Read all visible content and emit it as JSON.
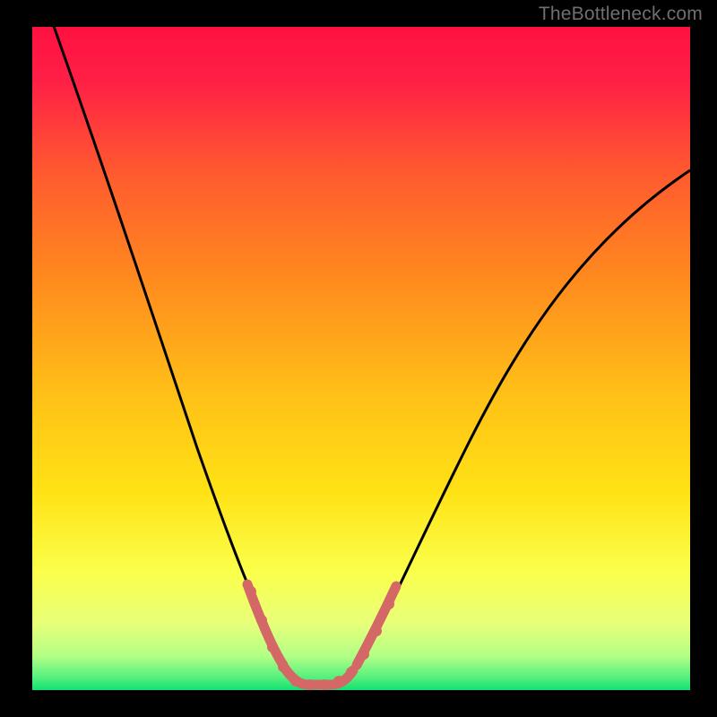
{
  "watermark": "TheBottleneck.com",
  "chart_data": {
    "type": "line",
    "title": "",
    "xlabel": "",
    "ylabel": "",
    "xlim": [
      0,
      100
    ],
    "ylim": [
      0,
      100
    ],
    "x": [
      0,
      5,
      10,
      15,
      20,
      25,
      30,
      33,
      36,
      38,
      40,
      42,
      44,
      46,
      48,
      50,
      55,
      60,
      65,
      70,
      75,
      80,
      85,
      90,
      95,
      100
    ],
    "values": [
      100,
      91,
      81,
      71,
      60,
      48,
      35,
      25,
      15,
      8,
      3,
      0,
      0,
      0,
      3,
      8,
      20,
      32,
      42,
      51,
      58,
      64,
      69,
      73,
      76,
      79
    ],
    "note": "Axis values are inferred qualitatively; the chart has no numeric tick labels. Values represent estimated bottleneck percentage (y) vs component ratio index (x).",
    "highlight_segments": [
      {
        "x_range": [
          33,
          38
        ],
        "color": "#d86a69"
      },
      {
        "x_range": [
          38,
          48
        ],
        "color": "#d86a69"
      },
      {
        "x_range": [
          48,
          52
        ],
        "color": "#d86a69"
      }
    ],
    "background_gradient": {
      "top": "#ff1744",
      "mid1": "#ff8a00",
      "mid2": "#ffe400",
      "low": "#f6ff8a",
      "bottom": "#10e070"
    }
  }
}
